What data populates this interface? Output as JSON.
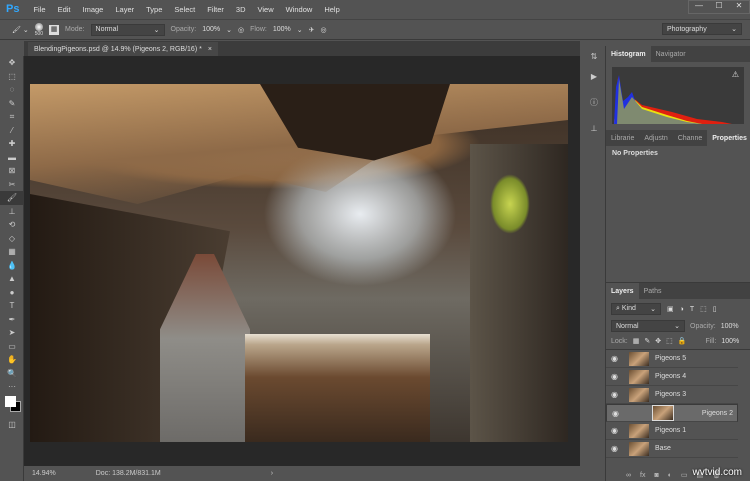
{
  "app": {
    "logo": "Ps"
  },
  "menu": [
    "File",
    "Edit",
    "Image",
    "Layer",
    "Type",
    "Select",
    "Filter",
    "3D",
    "View",
    "Window",
    "Help"
  ],
  "window_controls": [
    "—",
    "☐",
    "✕"
  ],
  "options": {
    "brush_size": "500",
    "mode_label": "Mode:",
    "mode": "Normal",
    "opacity_label": "Opacity:",
    "opacity": "100%",
    "flow_label": "Flow:",
    "flow": "100%",
    "workspace": "Photography"
  },
  "document": {
    "tab": "BlendingPigeons.psd @ 14.9% (Pigeons 2, RGB/16) *",
    "close": "×"
  },
  "status": {
    "zoom": "14.94%",
    "doc": "Doc: 138.2M/831.1M",
    "arrow": "›"
  },
  "histogram": {
    "tabs": [
      "Histogram",
      "Navigator"
    ],
    "warning": "⚠"
  },
  "properties": {
    "tabs": [
      "Librarie",
      "Adjustn",
      "Channe",
      "Properties"
    ],
    "content": "No Properties"
  },
  "layers": {
    "tabs": [
      "Layers",
      "Paths"
    ],
    "filter": "Kind",
    "blend": "Normal",
    "opacity_label": "Opacity:",
    "opacity": "100%",
    "lock_label": "Lock:",
    "fill_label": "Fill:",
    "fill": "100%",
    "items": [
      {
        "name": "Pigeons 5"
      },
      {
        "name": "Pigeons 4"
      },
      {
        "name": "Pigeons 3"
      },
      {
        "name": "Pigeons 2",
        "selected": true
      },
      {
        "name": "Pigeons 1"
      },
      {
        "name": "Base"
      }
    ],
    "footer": [
      "∞",
      "fx",
      "◙",
      "◐",
      "▭",
      "▤",
      "🗑"
    ]
  },
  "watermark": "wvtvid.com"
}
